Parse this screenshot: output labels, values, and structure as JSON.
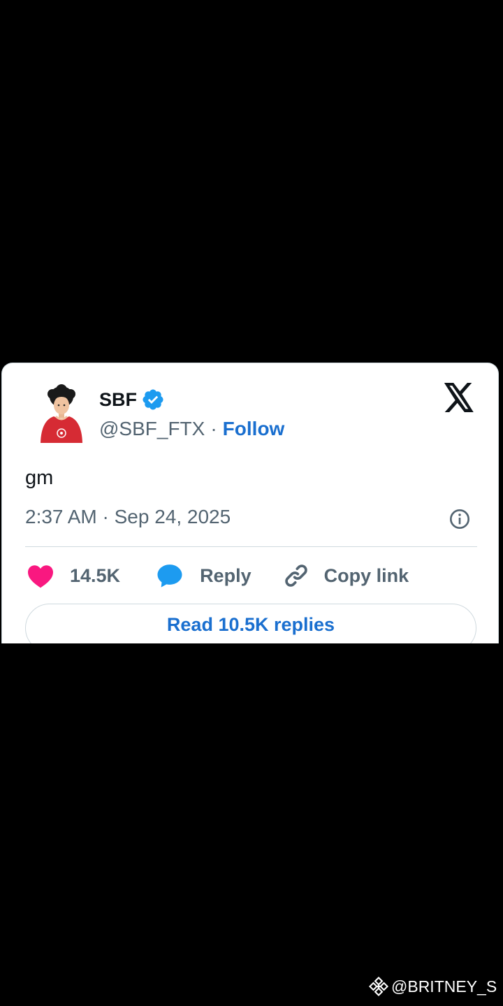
{
  "tweet": {
    "display_name": "SBF",
    "handle": "@SBF_FTX",
    "separator": "·",
    "follow_label": "Follow",
    "text": "gm",
    "timestamp": "2:37 AM · Sep 24, 2025",
    "likes_count": "14.5K",
    "reply_label": "Reply",
    "copy_link_label": "Copy link",
    "read_replies_label": "Read 10.5K replies"
  },
  "icons": {
    "verified": "verified-badge-icon",
    "platform_logo": "x-logo-icon",
    "info": "info-icon",
    "like": "heart-icon",
    "reply": "speech-bubble-icon",
    "copy_link": "link-icon",
    "watermark": "binance-logo-icon"
  },
  "colors": {
    "accent": "#1a6fcf",
    "verified": "#1d9bf0",
    "heart": "#f91880",
    "muted": "#536471",
    "text": "#0f1419"
  },
  "watermark": {
    "text": "@BRITNEY_S"
  }
}
